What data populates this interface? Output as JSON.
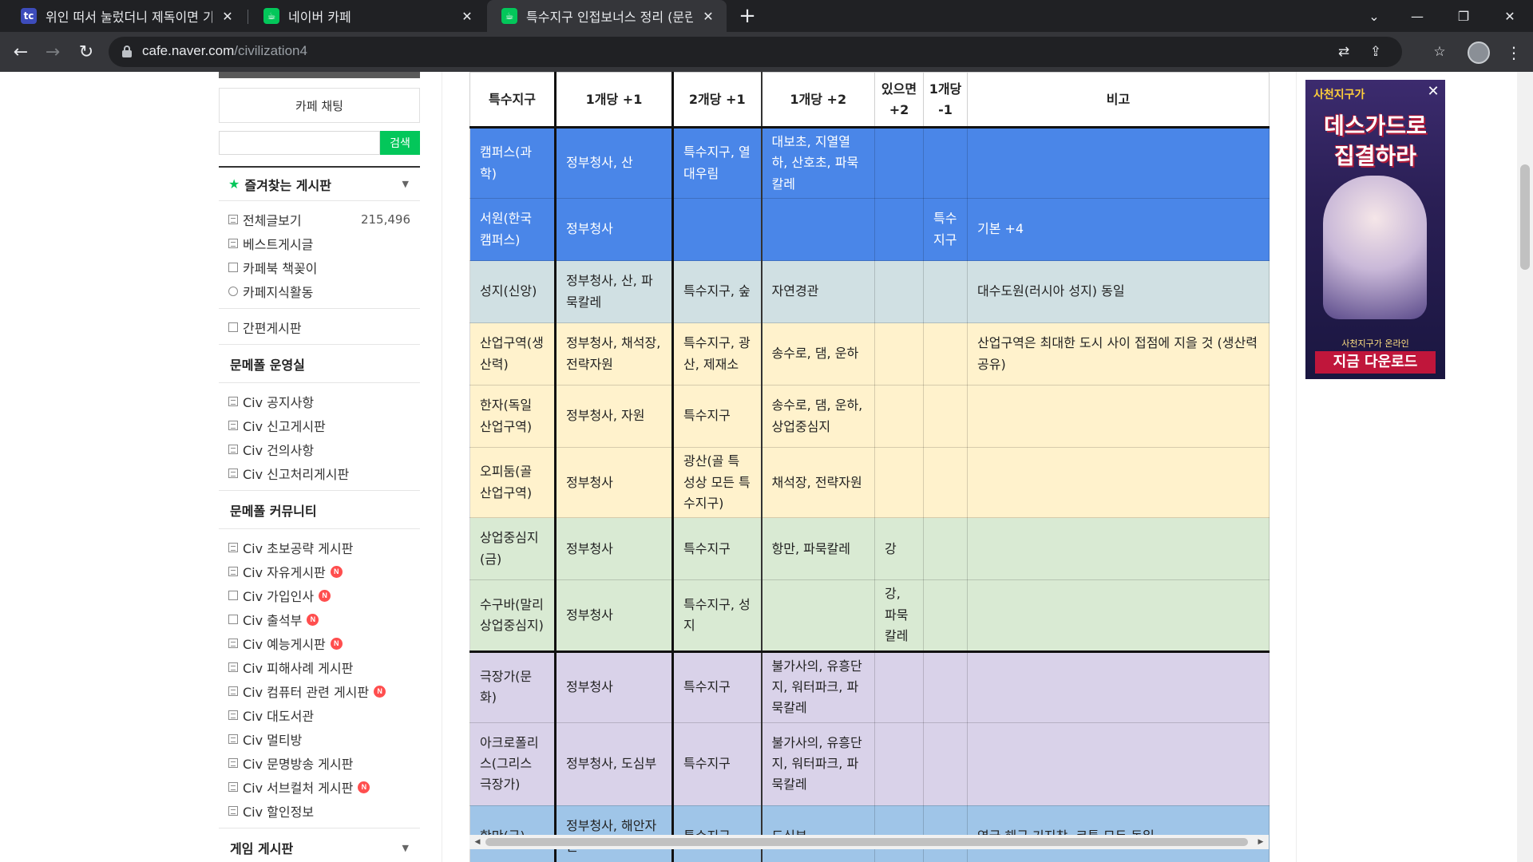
{
  "browser": {
    "tabs": [
      {
        "title": "위인 떠서 눌렀더니 제독이면 기",
        "favicon": "blue"
      },
      {
        "title": "네이버 카페",
        "favicon": "green"
      },
      {
        "title": "특수지구 인접보너스 정리 (문린",
        "favicon": "green",
        "active": true
      }
    ],
    "url_host": "cafe.naver.com",
    "url_path": "/civilization4"
  },
  "sidebar": {
    "chat_label": "카페 채팅",
    "search_placeholder": "",
    "search_button": "검색",
    "favorites_title": "즐겨찾는 게시판",
    "group1": [
      {
        "label": "전체글보기",
        "count": "215,496"
      },
      {
        "label": "베스트게시글"
      },
      {
        "label": "카페북 책꽂이"
      },
      {
        "label": "카페지식활동"
      }
    ],
    "group2": [
      {
        "label": "간편게시판"
      }
    ],
    "section_admin": "문메폴 운영실",
    "admin_items": [
      {
        "label": "Civ 공지사항"
      },
      {
        "label": "Civ 신고게시판"
      },
      {
        "label": "Civ 건의사항"
      },
      {
        "label": "Civ 신고처리게시판"
      }
    ],
    "section_community": "문메폴 커뮤니티",
    "community_items": [
      {
        "label": "Civ 초보공략 게시판",
        "new": false
      },
      {
        "label": "Civ 자유게시판",
        "new": true
      },
      {
        "label": "Civ 가입인사",
        "new": true
      },
      {
        "label": "Civ 출석부",
        "new": true
      },
      {
        "label": "Civ 예능게시판",
        "new": true
      },
      {
        "label": "Civ 피해사례 게시판",
        "new": false
      },
      {
        "label": "Civ 컴퓨터 관련 게시판",
        "new": true
      },
      {
        "label": "Civ 대도서관",
        "new": false
      },
      {
        "label": "Civ 멀티방",
        "new": false
      },
      {
        "label": "Civ 문명방송 게시판",
        "new": false
      },
      {
        "label": "Civ 서브컬처 게시판",
        "new": true
      },
      {
        "label": "Civ 할인정보",
        "new": false
      }
    ],
    "section_next": "게임 게시판",
    "new_badge": "N"
  },
  "table": {
    "headers": [
      "특수지구",
      "1개당 +1",
      "2개당 +1",
      "1개당 +2",
      "있으면 +2",
      "1개당 -1",
      "비고"
    ],
    "rows": [
      {
        "cells": [
          "캠퍼스(과학)",
          "정부청사, 산",
          "특수지구, 열대우림",
          "대보초, 지열열하, 산호초, 파묵칼레",
          "",
          "",
          ""
        ]
      },
      {
        "cells": [
          "서원(한국 캠퍼스)",
          "정부청사",
          "",
          "",
          "",
          "특수지구",
          "기본 +4"
        ]
      },
      {
        "cells": [
          "성지(신앙)",
          "정부청사, 산, 파묵칼레",
          "특수지구, 숲",
          "자연경관",
          "",
          "",
          "대수도원(러시아 성지) 동일"
        ]
      },
      {
        "cells": [
          "산업구역(생산력)",
          "정부청사, 채석장, 전략자원",
          "특수지구, 광산, 제재소",
          "송수로, 댐, 운하",
          "",
          "",
          "산업구역은 최대한 도시 사이 접점에 지을 것 (생산력 공유)"
        ]
      },
      {
        "cells": [
          "한자(독일 산업구역)",
          "정부청사, 자원",
          "특수지구",
          "송수로, 댐, 운하, 상업중심지",
          "",
          "",
          ""
        ]
      },
      {
        "cells": [
          "오피둠(골 산업구역)",
          "정부청사",
          "광산(골 특성상 모든 특수지구)",
          "채석장, 전략자원",
          "",
          "",
          ""
        ]
      },
      {
        "cells": [
          "상업중심지(금)",
          "정부청사",
          "특수지구",
          "항만, 파묵칼레",
          "강",
          "",
          ""
        ]
      },
      {
        "cells": [
          "수구바(말리 상업중심지)",
          "정부청사",
          "특수지구, 성지",
          "",
          "강, 파묵칼레",
          "",
          ""
        ]
      },
      {
        "cells": [
          "극장가(문화)",
          "정부청사",
          "특수지구",
          "불가사의, 유흥단지, 워터파크, 파묵칼레",
          "",
          "",
          ""
        ]
      },
      {
        "cells": [
          "아크로폴리스(그리스 극장가)",
          "정부청사, 도심부",
          "특수지구",
          "불가사의, 유흥단지, 워터파크, 파묵칼레",
          "",
          "",
          ""
        ]
      },
      {
        "cells": [
          "항만(금)",
          "정부청사, 해안자원",
          "특수지구",
          "도심부",
          "",
          "",
          "영국 해군 기지창, 코톤 모두 동일"
        ]
      }
    ]
  },
  "ad": {
    "brand": "사천지구가",
    "headline1": "데스가드로",
    "headline2": "집결하라",
    "sub": "사천지구가 온라인",
    "cta": "지금 다운로드",
    "close": "✕"
  },
  "colors": {
    "blue": "#4a86e8",
    "teal": "#d0e0e3",
    "yellow": "#fff2cc",
    "green": "#d9ead3",
    "purple": "#d9d2e9",
    "sky": "#9fc5e8",
    "naver_green": "#03c75a"
  },
  "icons": [
    "back-icon",
    "forward-icon",
    "reload-icon",
    "lock-icon",
    "share-icon",
    "star-icon",
    "menu-icon",
    "close-icon"
  ]
}
